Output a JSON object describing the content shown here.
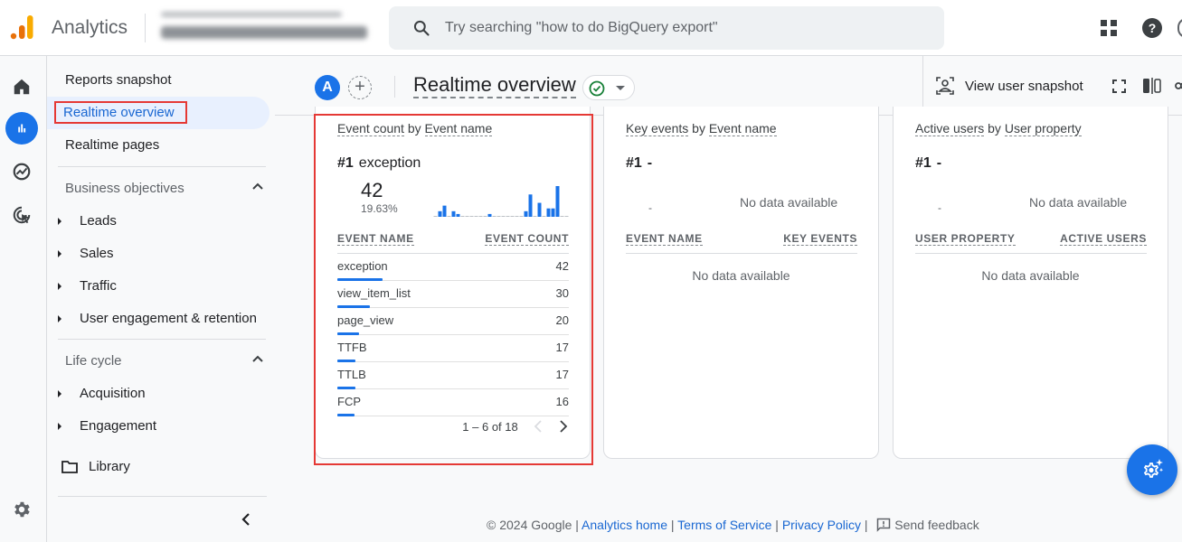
{
  "app": {
    "brand": "Analytics",
    "account_name": "[blurred account]",
    "search_placeholder": "Try searching \"how to do BigQuery export\""
  },
  "colors": {
    "accent": "#1a73e8",
    "logo_orange_dark": "#e8710a",
    "logo_orange_light": "#f9ab00",
    "highlight_red": "#e53935"
  },
  "rail": {
    "items": [
      {
        "icon": "home-icon",
        "label": "Home"
      },
      {
        "icon": "reports-icon",
        "label": "Reports",
        "active": true
      },
      {
        "icon": "explore-icon",
        "label": "Explore"
      },
      {
        "icon": "advertising-icon",
        "label": "Advertising"
      }
    ],
    "admin_icon": "gear-icon"
  },
  "nav": {
    "reports_snapshot": "Reports snapshot",
    "realtime_overview": "Realtime overview",
    "realtime_pages": "Realtime pages",
    "business_objectives": {
      "title": "Business objectives",
      "items": [
        "Leads",
        "Sales",
        "Traffic",
        "User engagement & retention"
      ]
    },
    "life_cycle": {
      "title": "Life cycle",
      "items": [
        "Acquisition",
        "Engagement"
      ]
    },
    "library": "Library"
  },
  "subheader": {
    "avatar_letter": "A",
    "add_comparison": "+",
    "title": "Realtime overview",
    "view_user_snapshot": "View user snapshot"
  },
  "cards": [
    {
      "title_metric": "Event count",
      "title_by": "by",
      "title_dimension": "Event name",
      "rank_label": "#1",
      "rank_value": "exception",
      "big_value": "42",
      "percent": "19.63%",
      "sparkline": [
        0,
        2,
        4,
        0,
        2,
        1,
        0,
        0,
        0,
        0,
        0,
        0,
        1,
        0,
        0,
        0,
        0,
        0,
        0,
        0,
        2,
        8,
        0,
        5,
        0,
        3,
        3,
        11,
        0,
        0
      ],
      "col1": "EVENT NAME",
      "col2": "EVENT COUNT",
      "rows": [
        {
          "name": "exception",
          "value": "42",
          "share": 1.0
        },
        {
          "name": "view_item_list",
          "value": "30",
          "share": 0.714
        },
        {
          "name": "page_view",
          "value": "20",
          "share": 0.476
        },
        {
          "name": "TTFB",
          "value": "17",
          "share": 0.405
        },
        {
          "name": "TTLB",
          "value": "17",
          "share": 0.405
        },
        {
          "name": "FCP",
          "value": "16",
          "share": 0.381
        }
      ],
      "pagination": "1 – 6 of 18"
    },
    {
      "title_metric": "Key events",
      "title_by": "by",
      "title_dimension": "Event name",
      "rank_label": "#1",
      "rank_value": "-",
      "small_dash": "-",
      "no_data_top": "No data available",
      "col1": "EVENT NAME",
      "col2": "KEY EVENTS",
      "no_data_table": "No data available"
    },
    {
      "title_metric": "Active users",
      "title_by": "by",
      "title_dimension": "User property",
      "rank_label": "#1",
      "rank_value": "-",
      "small_dash": "-",
      "no_data_top": "No data available",
      "col1": "USER PROPERTY",
      "col2": "ACTIVE USERS",
      "no_data_table": "No data available"
    }
  ],
  "footer": {
    "copyright": "© 2024 Google",
    "links": [
      "Analytics home",
      "Terms of Service",
      "Privacy Policy"
    ],
    "sep": "|",
    "feedback": "Send feedback"
  }
}
